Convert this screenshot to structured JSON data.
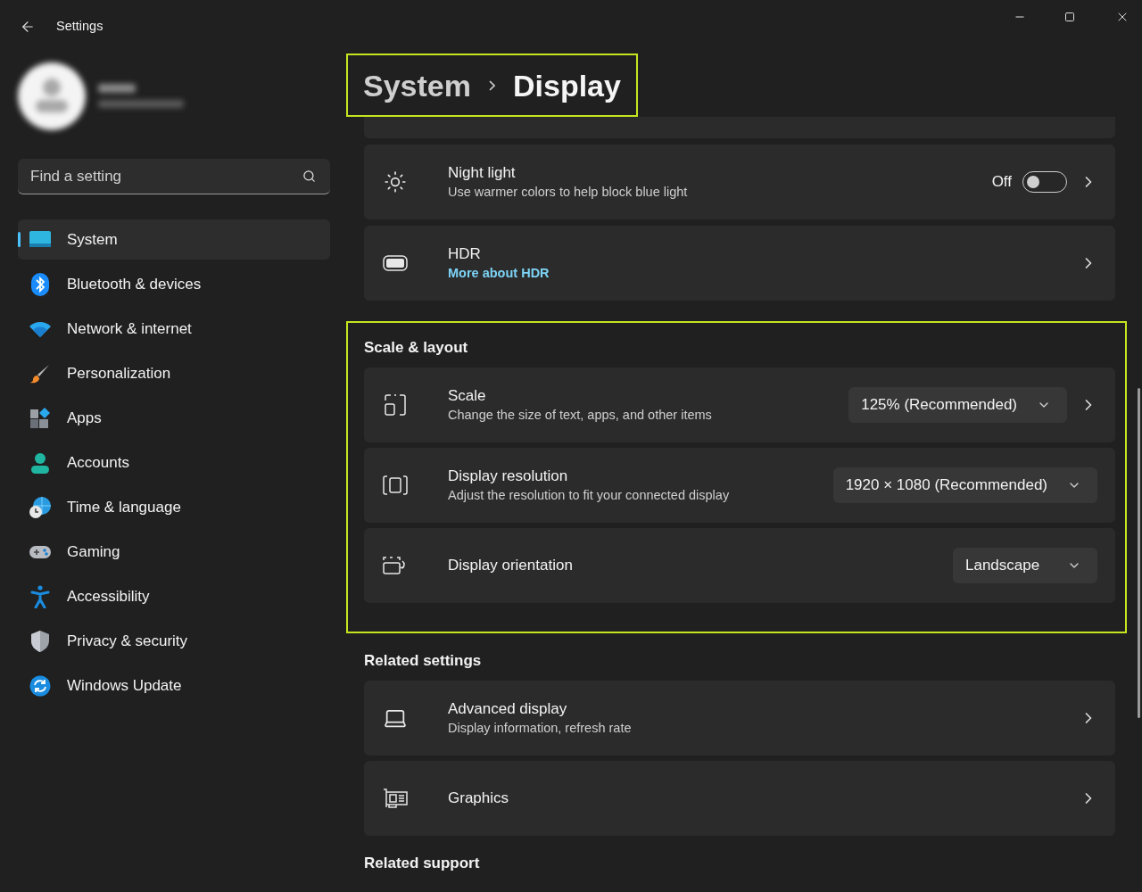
{
  "window": {
    "title": "Settings"
  },
  "search": {
    "placeholder": "Find a setting"
  },
  "nav": [
    {
      "label": "System",
      "selected": true
    },
    {
      "label": "Bluetooth & devices",
      "selected": false
    },
    {
      "label": "Network & internet",
      "selected": false
    },
    {
      "label": "Personalization",
      "selected": false
    },
    {
      "label": "Apps",
      "selected": false
    },
    {
      "label": "Accounts",
      "selected": false
    },
    {
      "label": "Time & language",
      "selected": false
    },
    {
      "label": "Gaming",
      "selected": false
    },
    {
      "label": "Accessibility",
      "selected": false
    },
    {
      "label": "Privacy & security",
      "selected": false
    },
    {
      "label": "Windows Update",
      "selected": false
    }
  ],
  "breadcrumb": {
    "parent": "System",
    "current": "Display",
    "highlighted": true
  },
  "top_cards": [
    {
      "title": "Night light",
      "subtitle": "Use warmer colors to help block blue light",
      "toggle": {
        "label": "Off",
        "on": false
      },
      "chevron": true
    },
    {
      "title": "HDR",
      "link": "More about HDR",
      "chevron": true
    }
  ],
  "sections": [
    {
      "heading": "Scale & layout",
      "highlighted": true,
      "cards": [
        {
          "title": "Scale",
          "subtitle": "Change the size of text, apps, and other items",
          "dropdown": "125% (Recommended)",
          "chevron": true
        },
        {
          "title": "Display resolution",
          "subtitle": "Adjust the resolution to fit your connected display",
          "dropdown": "1920 × 1080 (Recommended)",
          "chevron": false
        },
        {
          "title": "Display orientation",
          "dropdown": "Landscape",
          "chevron": false
        }
      ]
    },
    {
      "heading": "Related settings",
      "highlighted": false,
      "cards": [
        {
          "title": "Advanced display",
          "subtitle": "Display information, refresh rate",
          "chevron": true
        },
        {
          "title": "Graphics",
          "chevron": true
        }
      ]
    },
    {
      "heading": "Related support",
      "highlighted": false
    }
  ]
}
